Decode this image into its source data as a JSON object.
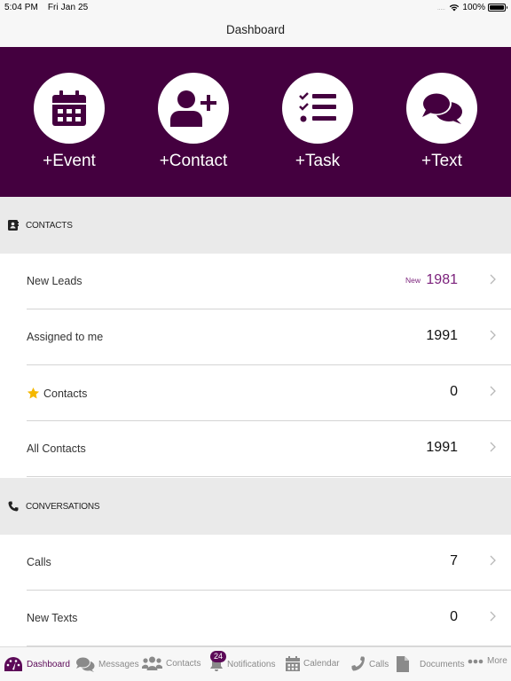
{
  "status_bar": {
    "time": "5:04 PM",
    "date": "Fri Jan 25",
    "signal": ".....",
    "battery": "100%"
  },
  "nav": {
    "title": "Dashboard"
  },
  "quick_actions": [
    {
      "label": "+Event",
      "icon": "calendar-icon"
    },
    {
      "label": "+Contact",
      "icon": "add-user-icon"
    },
    {
      "label": "+Task",
      "icon": "task-list-icon"
    },
    {
      "label": "+Text",
      "icon": "chat-bubbles-icon"
    }
  ],
  "contacts_section": {
    "header": "CONTACTS",
    "rows": [
      {
        "label": "New Leads",
        "badge": "New",
        "value": "1981"
      },
      {
        "label": "Assigned to me",
        "value": "1991"
      },
      {
        "label": "Contacts",
        "value": "0",
        "icon": "star-icon"
      },
      {
        "label": "All Contacts",
        "value": "1991"
      }
    ]
  },
  "conversations_section": {
    "header": "CONVERSATIONS",
    "rows": [
      {
        "label": "Calls",
        "value": "7"
      },
      {
        "label": "New Texts",
        "value": "0"
      }
    ]
  },
  "tab_bar": {
    "tabs": [
      {
        "label": "Dashboard",
        "active": true
      },
      {
        "label": "Messages"
      },
      {
        "label": "Contacts"
      },
      {
        "label": "Notifications",
        "badge": "24"
      },
      {
        "label": "Calendar"
      },
      {
        "label": "Calls"
      },
      {
        "label": "Documents"
      },
      {
        "label": "More"
      }
    ]
  },
  "colors": {
    "brand": "#44003f",
    "accent": "#7a1f7a",
    "star": "#f5b800"
  }
}
